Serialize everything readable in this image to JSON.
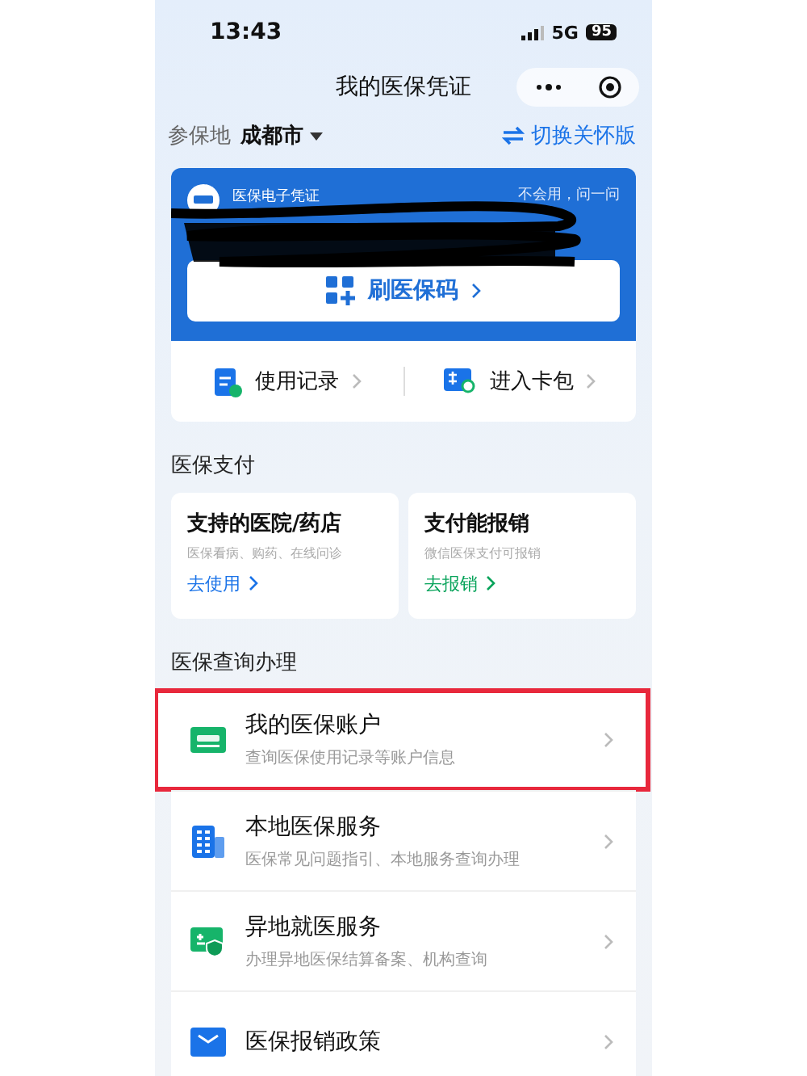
{
  "status_bar": {
    "time": "13:43",
    "network": "5G",
    "battery": "95"
  },
  "nav": {
    "title": "我的医保凭证"
  },
  "location": {
    "label": "参保地",
    "city": "成都市",
    "switch": "切换关怀版"
  },
  "card": {
    "title": "医保电子凭证",
    "help": "不会用，问一问",
    "button": "刷医保码",
    "links": [
      {
        "kind": "record",
        "label": "使用记录"
      },
      {
        "kind": "wallet",
        "label": "进入卡包"
      }
    ]
  },
  "payment": {
    "title": "医保支付",
    "cards": [
      {
        "title": "支持的医院/药店",
        "subtitle": "医保看病、购药、在线问诊",
        "action": "去使用",
        "color": "#1a73e8"
      },
      {
        "title": "支付能报销",
        "subtitle": "微信医保支付可报销",
        "action": "去报销",
        "color": "#07a35a"
      }
    ]
  },
  "services": {
    "title": "医保查询办理",
    "items": [
      {
        "kind": "account",
        "title": "我的医保账户",
        "subtitle": "查询医保使用记录等账户信息",
        "highlighted": true
      },
      {
        "kind": "local",
        "title": "本地医保服务",
        "subtitle": "医保常见问题指引、本地服务查询办理",
        "highlighted": false
      },
      {
        "kind": "remote",
        "title": "异地就医服务",
        "subtitle": "办理异地医保结算备案、机构查询",
        "highlighted": false
      },
      {
        "kind": "policy",
        "title": "医保报销政策",
        "highlighted": false
      }
    ]
  }
}
